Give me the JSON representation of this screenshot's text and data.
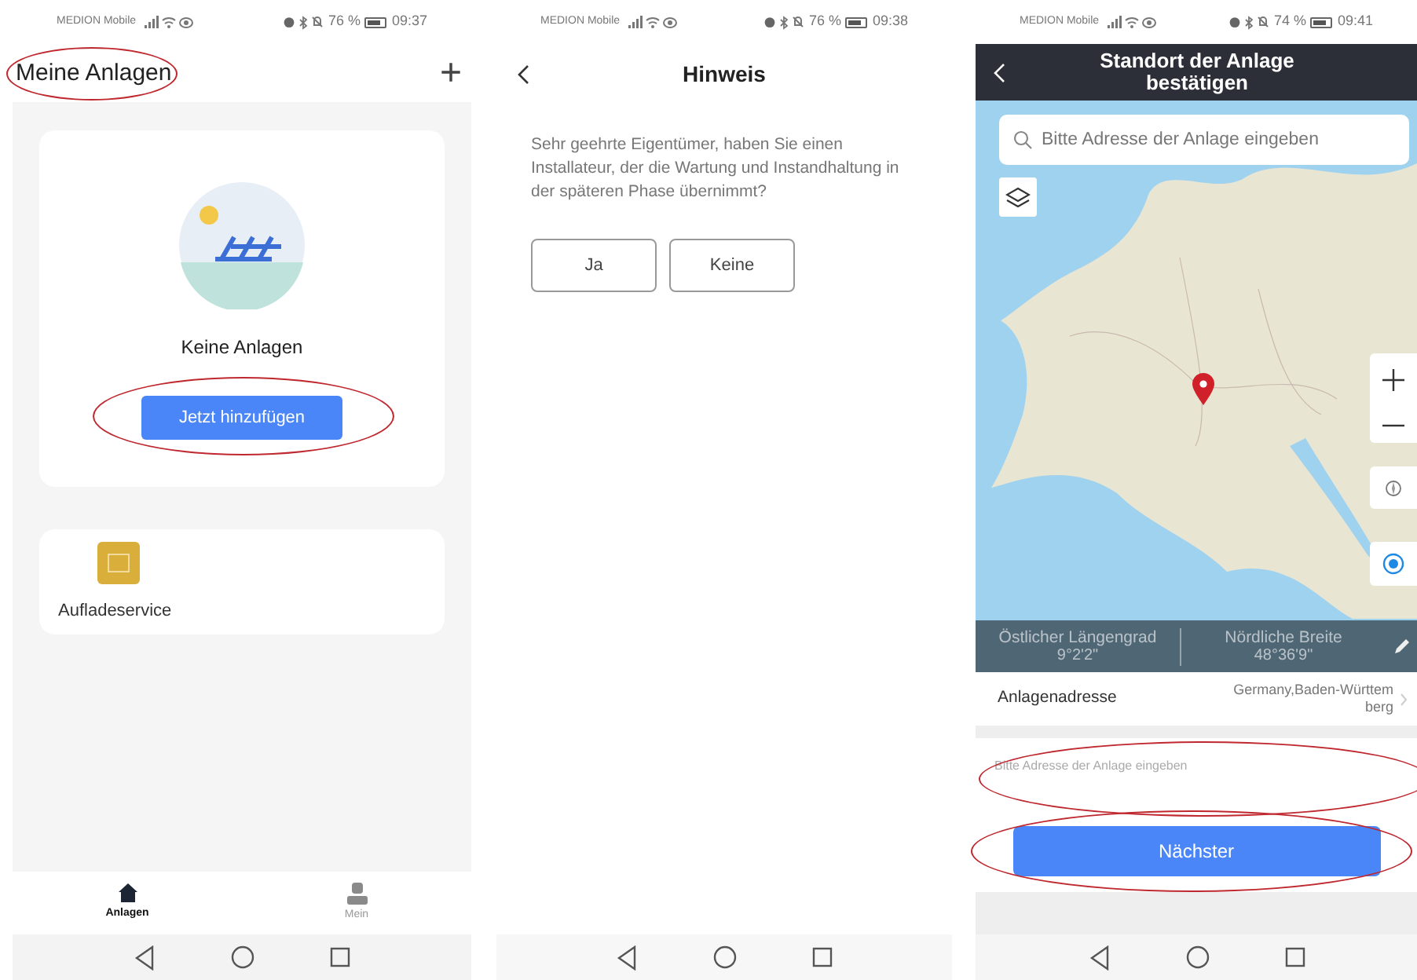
{
  "plants_screen": {
    "status_bar": {
      "carrier": "MEDION Mobile",
      "battery": "76 %",
      "time": "09:37"
    },
    "header": {
      "title": "Meine Anlagen",
      "title_highlighted": true,
      "add_button": "+"
    },
    "empty_card": {
      "text": "Keine Anlagen",
      "button": "Jetzt hinzufügen",
      "button_highlighted": true
    },
    "service_card": {
      "label": "Aufladeservice"
    },
    "tabs": [
      {
        "label": "Anlagen",
        "selected": true
      },
      {
        "label": "Mein",
        "selected": false
      }
    ]
  },
  "notice_screen": {
    "status_bar": {
      "carrier": "MEDION Mobile",
      "battery": "76 %",
      "time": "09:38"
    },
    "title": "Hinweis",
    "message": "Sehr geehrte Eigentümer, haben Sie einen Installateur, der die Wartung und Instandhaltung in der späteren Phase übernimmt?",
    "buttons": [
      "Ja",
      "Keine"
    ]
  },
  "location_screen": {
    "status_bar": {
      "carrier": "MEDION Mobile",
      "battery": "74 %",
      "time": "09:41"
    },
    "title": "Standort der Anlage bestätigen",
    "map_search": {
      "placeholder": "Bitte Adresse der Anlage eingeben"
    },
    "coordinates": [
      {
        "label": "Östlicher Längengrad",
        "value": "9°2'2\""
      },
      {
        "label": "Nördliche Breite",
        "value": "48°36'9\""
      }
    ],
    "address": {
      "label": "Anlagenadresse",
      "value": "Germany,Baden-Württemberg"
    },
    "address_field": {
      "placeholder": "Bitte Adresse der Anlage eingeben",
      "highlighted": true
    },
    "next_button": {
      "label": "Nächster",
      "highlighted": true
    }
  }
}
